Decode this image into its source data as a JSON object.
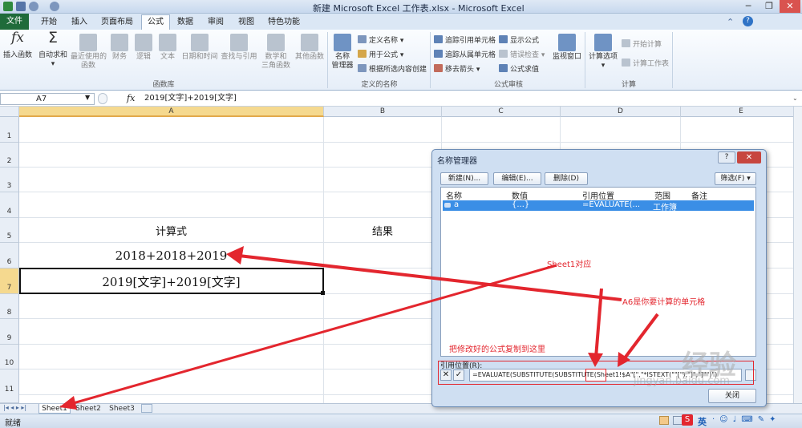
{
  "window": {
    "title": "新建 Microsoft Excel 工作表.xlsx - Microsoft Excel"
  },
  "tabs": [
    "开始",
    "插入",
    "页面布局",
    "公式",
    "数据",
    "审阅",
    "视图",
    "特色功能"
  ],
  "file_tab": "文件",
  "active_tab": "公式",
  "ribbon": {
    "insert_function": "插入函数",
    "autosum": "自动求和",
    "recent": "最近使用的\n函数",
    "financial": "财务",
    "logical": "逻辑",
    "text": "文本",
    "datetime": "日期和时间",
    "lookup": "查找与引用",
    "math": "数学和\n三角函数",
    "other": "其他函数",
    "group_library": "函数库",
    "name_manager": "名称\n管理器",
    "define_name": "定义名称",
    "use_in_formula": "用于公式",
    "create_from_selection": "根据所选内容创建",
    "group_names": "定义的名称",
    "trace_precedents": "追踪引用单元格",
    "trace_dependents": "追踪从属单元格",
    "remove_arrows": "移去箭头",
    "show_formulas": "显示公式",
    "error_check": "错误检查",
    "evaluate": "公式求值",
    "watch": "监视窗口",
    "group_audit": "公式审核",
    "calc_options": "计算选项",
    "calc_now": "开始计算",
    "calc_sheet": "计算工作表",
    "group_calc": "计算"
  },
  "namebox": "A7",
  "formula_label": "fx",
  "formula": "2019[文字]+2019[文字]",
  "columns": [
    "A",
    "B",
    "C",
    "D",
    "E"
  ],
  "rows": [
    "1",
    "2",
    "3",
    "4",
    "5",
    "6",
    "7",
    "8",
    "9",
    "10",
    "11"
  ],
  "cells": {
    "a5": "计算式",
    "b5": "结果",
    "a6": "2018+2018+2019",
    "a7": "2019[文字]+2019[文字]"
  },
  "sheets": [
    "Sheet1",
    "Sheet2",
    "Sheet3"
  ],
  "status": "就绪",
  "status_ime": "英",
  "dialog": {
    "title": "名称管理器",
    "help": "?",
    "new": "新建(N)...",
    "edit": "编辑(E)...",
    "delete": "删除(D)",
    "filter": "筛选(F)",
    "headers": [
      "名称",
      "数值",
      "引用位置",
      "范围",
      "备注"
    ],
    "row": {
      "name": "a",
      "value": "{...}",
      "ref": "=EVALUATE(...",
      "scope": "工作簿"
    },
    "refers_label": "引用位置(R):",
    "refers_value": "=EVALUATE(SUBSTITUTE(SUBSTITUTE(Sheet1!$A",
    "refers_tail": "\"[\",\"*ISTEXT(\"\"[\"),\"]\",\"]\"\")\")",
    "close": "关闭"
  },
  "annotations": {
    "sheet1": "Sheet1对应",
    "a6": "A6是你要计算的单元格",
    "paste": "把修改好的公式复制到这里"
  },
  "watermark": {
    "text": "经验",
    "url": "jingyan.baidu.com"
  },
  "colors": {
    "accent": "#1f6b3a",
    "annot": "#e3262e",
    "selection": "#3a8ee6"
  }
}
